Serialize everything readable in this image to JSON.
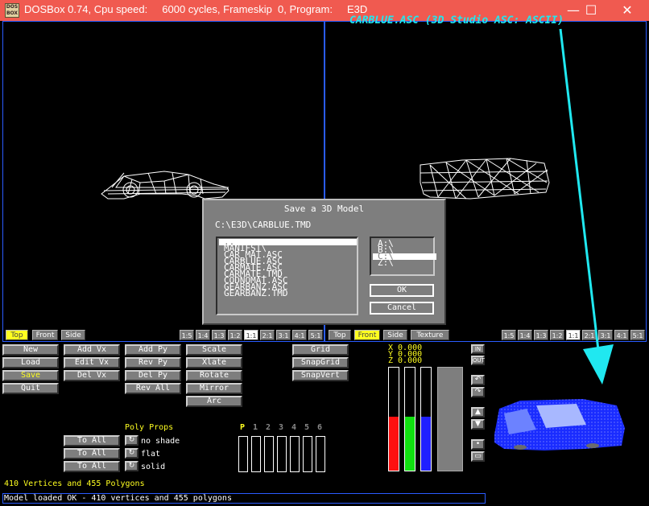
{
  "window": {
    "title": "DOSBox 0.74, Cpu speed:     6000 cycles, Frameskip  0, Program:     E3D",
    "icon_text": "DOS BOX",
    "controls": {
      "minimize": "—",
      "maximize": "☐",
      "close": "✕"
    }
  },
  "annotation": {
    "label": "CARBLUE.ASC (3D Studio ASC: ASCII)",
    "arrow_color": "#20e8f0"
  },
  "left_viewport": {
    "view_buttons": [
      "Top",
      "Front",
      "Side"
    ],
    "active_view": "Top",
    "zoom_buttons": [
      "1:5",
      "1:4",
      "1:3",
      "1:2",
      "1:1",
      "2:1",
      "3:1",
      "4:1",
      "5:1"
    ],
    "active_zoom": "1:1"
  },
  "right_viewport": {
    "view_buttons": [
      "Top",
      "Front",
      "Side",
      "Texture"
    ],
    "active_view": "Front",
    "zoom_buttons": [
      "1:5",
      "1:4",
      "1:3",
      "1:2",
      "1:1",
      "2:1",
      "3:1",
      "4:1",
      "5:1"
    ],
    "active_zoom": "1:1"
  },
  "dialog": {
    "title": "Save a 3D Model",
    "path": "C:\\E3D\\CARBLUE.TMD",
    "files": [
      "..",
      "MANIFST\\",
      "CAR_MAT.ASC",
      "CARBLUE.ASC",
      "CARMATE.ASC",
      "CARMATE.TMD",
      "CODNOMAT.ASC",
      "GEARBANZ.ASC",
      "GEARBANZ.TMD"
    ],
    "drives": [
      "A:\\",
      "B:\\",
      "C:\\",
      "Z:\\"
    ],
    "selected_drive": "C:\\",
    "ok_label": "OK",
    "cancel_label": "Cancel"
  },
  "toolbar": {
    "file": [
      "New",
      "Load",
      "Save",
      "Quit"
    ],
    "active_file": "Save",
    "vertex": [
      "Add Vx",
      "Edit Vx",
      "Del Vx"
    ],
    "poly": [
      "Add Py",
      "Rev Py",
      "Del Py",
      "Rev All"
    ],
    "transform": [
      "Scale",
      "Xlate",
      "Rotate",
      "Mirror",
      "Arc"
    ],
    "grid": [
      "Grid",
      "SnapGrid",
      "SnapVert"
    ]
  },
  "coords": {
    "x": "X 0.000",
    "y": "Y 0.000",
    "z": "Z 0.000"
  },
  "zoom_controls": {
    "in": "IN",
    "out": "OUT"
  },
  "poly_props": {
    "title": "Poly Props",
    "to_all_label": "To All",
    "options": [
      "no shade",
      "flat",
      "solid"
    ]
  },
  "palette": {
    "selected": "P",
    "slots": [
      "1",
      "2",
      "3",
      "4",
      "5",
      "6"
    ]
  },
  "color_sliders": [
    {
      "name": "red",
      "color": "#ff1010",
      "level": 0.52
    },
    {
      "name": "green",
      "color": "#10e010",
      "level": 0.52
    },
    {
      "name": "blue",
      "color": "#2020ff",
      "level": 0.52
    }
  ],
  "stats": "410 Vertices and 455 Polygons",
  "status": "Model loaded OK - 410 vertices and 455 polygons"
}
